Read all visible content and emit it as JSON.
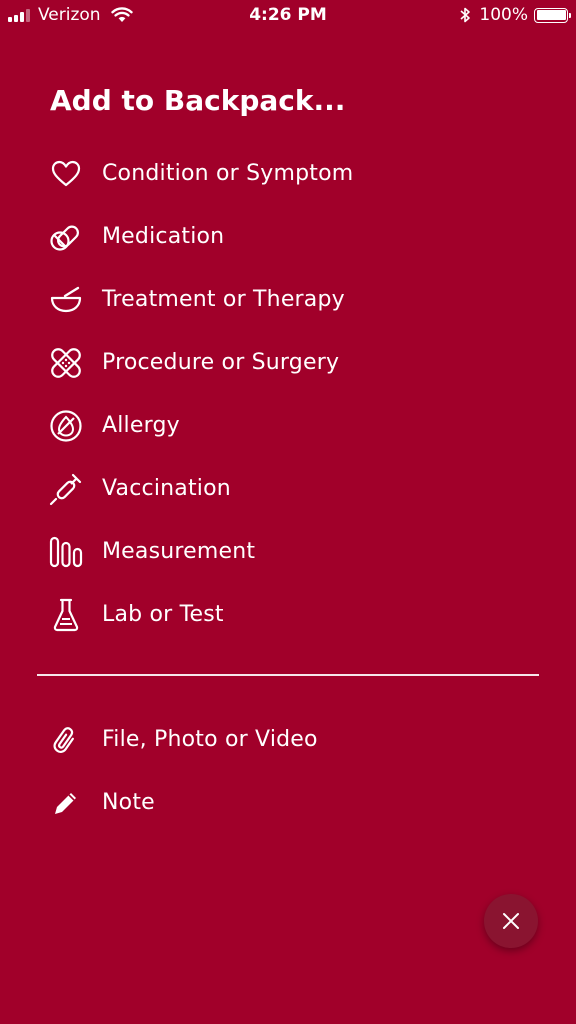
{
  "status_bar": {
    "carrier": "Verizon",
    "time": "4:26 PM",
    "battery": "100%",
    "battery_level": 1.0,
    "signal_bars": 3
  },
  "colors": {
    "background": "#a1002a",
    "close_button": "#8a1430",
    "text": "#ffffff"
  },
  "title": "Add to Backpack...",
  "items": [
    {
      "label": "Condition or Symptom",
      "icon": "heart-icon"
    },
    {
      "label": "Medication",
      "icon": "pills-icon"
    },
    {
      "label": "Treatment or Therapy",
      "icon": "mortar-pestle-icon"
    },
    {
      "label": "Procedure or Surgery",
      "icon": "bandage-icon"
    },
    {
      "label": "Allergy",
      "icon": "allergy-icon"
    },
    {
      "label": "Vaccination",
      "icon": "syringe-icon"
    },
    {
      "label": "Measurement",
      "icon": "measurement-bars-icon"
    },
    {
      "label": "Lab or Test",
      "icon": "flask-icon"
    }
  ],
  "secondary_items": [
    {
      "label": "File, Photo or Video",
      "icon": "paperclip-icon"
    },
    {
      "label": "Note",
      "icon": "pencil-icon"
    }
  ],
  "close_icon": "close-icon"
}
